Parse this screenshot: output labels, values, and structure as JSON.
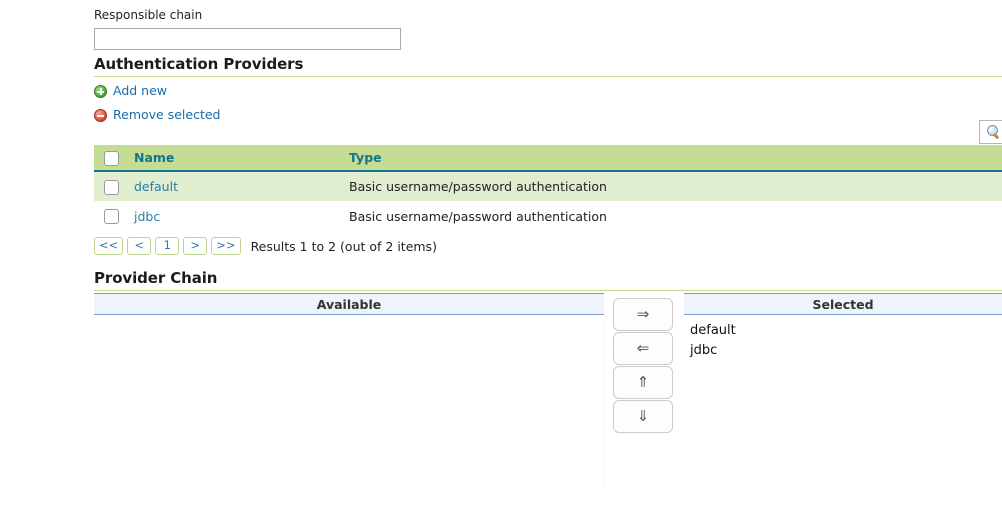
{
  "responsible_chain": {
    "label": "Responsible chain",
    "value": "",
    "placeholder": ""
  },
  "auth_providers": {
    "heading": "Authentication Providers",
    "add_new_label": "Add new",
    "remove_selected_label": "Remove selected",
    "search_icon": "search-icon",
    "table": {
      "columns": [
        "",
        "Name",
        "Type"
      ],
      "rows": [
        {
          "name": "default",
          "type": "Basic username/password authentication"
        },
        {
          "name": "jdbc",
          "type": "Basic username/password authentication"
        }
      ]
    },
    "pagination": {
      "first": "<<",
      "prev": "<",
      "pages": [
        "1"
      ],
      "next": ">",
      "last": ">>",
      "results_text": "Results 1 to 2 (out of 2 items)"
    }
  },
  "provider_chain": {
    "heading": "Provider Chain",
    "available_header": "Available",
    "selected_header": "Selected",
    "available_items": [],
    "selected_items": [
      "default",
      "jdbc"
    ],
    "transfer_buttons": [
      {
        "name": "move-right-button",
        "glyph": "⇒"
      },
      {
        "name": "move-left-button",
        "glyph": "⇐"
      },
      {
        "name": "move-up-button",
        "glyph": "⇑"
      },
      {
        "name": "move-down-button",
        "glyph": "⇓"
      }
    ]
  },
  "colors": {
    "table_header_green": "#c4dc93",
    "row_stripe_green": "#e1edcf",
    "header_text_teal": "#14758a",
    "link_blue": "#1a6ca8",
    "pane_header_blue": "#eef3fc",
    "pane_border_blue": "#7a9cc6",
    "heading_rule_olive": "#c9d88c"
  }
}
